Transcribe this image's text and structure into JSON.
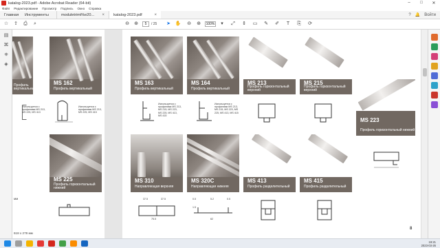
{
  "window": {
    "title": "katalog-2023.pdf - Adobe Acrobat Reader (64-bit)"
  },
  "menu": {
    "items": [
      "Файл",
      "Редактирование",
      "Просмотр",
      "Подпись",
      "Окно",
      "Справка"
    ]
  },
  "tabs": {
    "home": "Главная",
    "tools": "Инструменты",
    "doc1": "moduletrimt%e20...",
    "doc2": "katalog-2023.pdf",
    "signin": "Войти"
  },
  "toolbar": {
    "page_current": "5",
    "page_total": "/ 25",
    "zoom": "100%"
  },
  "left_page": {
    "cards": [
      {
        "code": "",
        "desc": "Профиль вертикальный"
      },
      {
        "code": "MS 162",
        "desc": "Профиль вертикальный"
      },
      {
        "code": "MS 225",
        "desc": "Профиль горизонтальный нижний"
      }
    ],
    "notes": [
      "Используется с профилями MS 213, MS 225, MS 413",
      "Используется с профилями MS 213, MS 225, MS 415"
    ],
    "side_label": "мм",
    "page_size": "618 x 278 мм"
  },
  "right_page": {
    "cards": [
      {
        "code": "MS 163",
        "desc": "Профиль вертикальный"
      },
      {
        "code": "MS 164",
        "desc": "Профиль вертикальный"
      },
      {
        "code": "MS 213",
        "desc": "Профиль горизонтальный верхний"
      },
      {
        "code": "MS 215",
        "desc": "Профиль горизонтальный верхний"
      },
      {
        "code": "MS 223",
        "desc": "Профиль горизонтальный нижний"
      },
      {
        "code": "MS 310",
        "desc": "Направляющая верхняя"
      },
      {
        "code": "MS 320C",
        "desc": "Направляющая нижняя"
      },
      {
        "code": "MS 413",
        "desc": "Профиль разделительный"
      },
      {
        "code": "MS 415",
        "desc": "Профиль разделительный"
      }
    ],
    "notes": [
      "Используется с профилями MS 213, MS 215, MS 223, MS 225, MS 413, MS 415",
      "Используется с профилями MS 213, MS 215, MS 223, MS 225, MS 413, MS 415"
    ],
    "dims": {
      "ms310_left": "37.5",
      "ms310_right": "37.5",
      "ms310_total": "75.5",
      "ms320c_a": "0.5",
      "ms320c_b": "5.2",
      "ms320c_c": "0.5",
      "ms320c_d": "1.5",
      "ms320c_total": "62"
    },
    "page_number": "8"
  },
  "taskbar": {
    "time": "19:21",
    "date": "2023-03-26"
  },
  "colors": {
    "card_bg": "#716861",
    "acrobat_red": "#d4261c",
    "accent_blue": "#1473e6"
  }
}
